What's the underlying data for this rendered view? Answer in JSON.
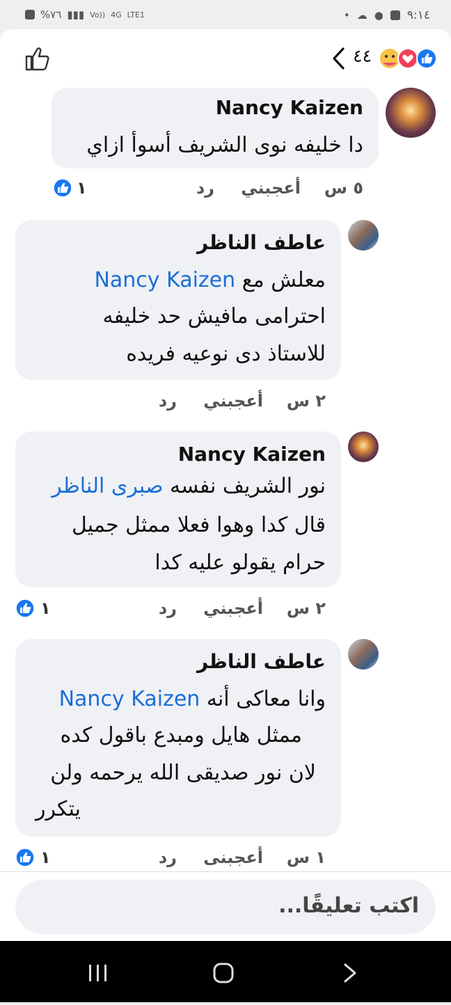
{
  "status_bar": {
    "left": [
      "%٧٦",
      "Vo))",
      "4G",
      "LTE1"
    ],
    "time": "٩:١٤"
  },
  "header": {
    "reaction_count": "٤٤",
    "reactions": [
      "like-icon",
      "love-icon",
      "care-icon"
    ]
  },
  "comments": [
    {
      "author": "Nancy Kaizen",
      "lines": [
        "دا خليفه نوى الشريف أسوأ ازاي"
      ],
      "time": "٥ س",
      "like_label": "أعجبني",
      "reply_label": "رد",
      "like_count": "١"
    },
    {
      "author": "عاطف الناظر",
      "mention": "Nancy Kaizen",
      "lines": [
        "معلش مع",
        "احترامى مافيش حد خليفه",
        "للاستاذ دى نوعيه فريده"
      ],
      "time": "٢ س",
      "like_label": "أعجبني",
      "reply_label": "رد"
    },
    {
      "author": "Nancy Kaizen",
      "mention": "صبرى الناظر",
      "lines": [
        "نور الشريف نفسه",
        "قال كدا وهوا فعلا ممثل جميل",
        "حرام يقولو عليه كدا"
      ],
      "time": "٢ س",
      "like_label": "أعجبني",
      "reply_label": "رد",
      "like_count": "١"
    },
    {
      "author": "عاطف الناظر",
      "mention": "Nancy Kaizen",
      "lines": [
        "وانا معاكى أنه",
        "ممثل هايل ومبدع  باقول كده",
        "لان نور صديقى الله يرحمه ولن",
        "يتكرر"
      ],
      "time": "١ س",
      "like_label": "أعجبنى",
      "reply_label": "رد",
      "like_count": "١"
    }
  ],
  "composer": {
    "placeholder": "اكتب تعليقًا..."
  }
}
